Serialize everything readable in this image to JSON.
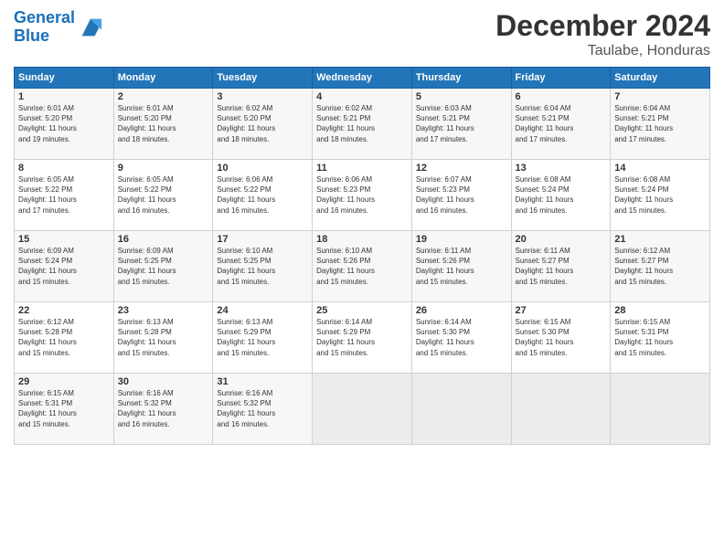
{
  "header": {
    "logo_line1": "General",
    "logo_line2": "Blue",
    "month_title": "December 2024",
    "location": "Taulabe, Honduras"
  },
  "days_of_week": [
    "Sunday",
    "Monday",
    "Tuesday",
    "Wednesday",
    "Thursday",
    "Friday",
    "Saturday"
  ],
  "weeks": [
    [
      {
        "day": "1",
        "detail": "Sunrise: 6:01 AM\nSunset: 5:20 PM\nDaylight: 11 hours\nand 19 minutes."
      },
      {
        "day": "2",
        "detail": "Sunrise: 6:01 AM\nSunset: 5:20 PM\nDaylight: 11 hours\nand 18 minutes."
      },
      {
        "day": "3",
        "detail": "Sunrise: 6:02 AM\nSunset: 5:20 PM\nDaylight: 11 hours\nand 18 minutes."
      },
      {
        "day": "4",
        "detail": "Sunrise: 6:02 AM\nSunset: 5:21 PM\nDaylight: 11 hours\nand 18 minutes."
      },
      {
        "day": "5",
        "detail": "Sunrise: 6:03 AM\nSunset: 5:21 PM\nDaylight: 11 hours\nand 17 minutes."
      },
      {
        "day": "6",
        "detail": "Sunrise: 6:04 AM\nSunset: 5:21 PM\nDaylight: 11 hours\nand 17 minutes."
      },
      {
        "day": "7",
        "detail": "Sunrise: 6:04 AM\nSunset: 5:21 PM\nDaylight: 11 hours\nand 17 minutes."
      }
    ],
    [
      {
        "day": "8",
        "detail": "Sunrise: 6:05 AM\nSunset: 5:22 PM\nDaylight: 11 hours\nand 17 minutes."
      },
      {
        "day": "9",
        "detail": "Sunrise: 6:05 AM\nSunset: 5:22 PM\nDaylight: 11 hours\nand 16 minutes."
      },
      {
        "day": "10",
        "detail": "Sunrise: 6:06 AM\nSunset: 5:22 PM\nDaylight: 11 hours\nand 16 minutes."
      },
      {
        "day": "11",
        "detail": "Sunrise: 6:06 AM\nSunset: 5:23 PM\nDaylight: 11 hours\nand 16 minutes."
      },
      {
        "day": "12",
        "detail": "Sunrise: 6:07 AM\nSunset: 5:23 PM\nDaylight: 11 hours\nand 16 minutes."
      },
      {
        "day": "13",
        "detail": "Sunrise: 6:08 AM\nSunset: 5:24 PM\nDaylight: 11 hours\nand 16 minutes."
      },
      {
        "day": "14",
        "detail": "Sunrise: 6:08 AM\nSunset: 5:24 PM\nDaylight: 11 hours\nand 15 minutes."
      }
    ],
    [
      {
        "day": "15",
        "detail": "Sunrise: 6:09 AM\nSunset: 5:24 PM\nDaylight: 11 hours\nand 15 minutes."
      },
      {
        "day": "16",
        "detail": "Sunrise: 6:09 AM\nSunset: 5:25 PM\nDaylight: 11 hours\nand 15 minutes."
      },
      {
        "day": "17",
        "detail": "Sunrise: 6:10 AM\nSunset: 5:25 PM\nDaylight: 11 hours\nand 15 minutes."
      },
      {
        "day": "18",
        "detail": "Sunrise: 6:10 AM\nSunset: 5:26 PM\nDaylight: 11 hours\nand 15 minutes."
      },
      {
        "day": "19",
        "detail": "Sunrise: 6:11 AM\nSunset: 5:26 PM\nDaylight: 11 hours\nand 15 minutes."
      },
      {
        "day": "20",
        "detail": "Sunrise: 6:11 AM\nSunset: 5:27 PM\nDaylight: 11 hours\nand 15 minutes."
      },
      {
        "day": "21",
        "detail": "Sunrise: 6:12 AM\nSunset: 5:27 PM\nDaylight: 11 hours\nand 15 minutes."
      }
    ],
    [
      {
        "day": "22",
        "detail": "Sunrise: 6:12 AM\nSunset: 5:28 PM\nDaylight: 11 hours\nand 15 minutes."
      },
      {
        "day": "23",
        "detail": "Sunrise: 6:13 AM\nSunset: 5:28 PM\nDaylight: 11 hours\nand 15 minutes."
      },
      {
        "day": "24",
        "detail": "Sunrise: 6:13 AM\nSunset: 5:29 PM\nDaylight: 11 hours\nand 15 minutes."
      },
      {
        "day": "25",
        "detail": "Sunrise: 6:14 AM\nSunset: 5:29 PM\nDaylight: 11 hours\nand 15 minutes."
      },
      {
        "day": "26",
        "detail": "Sunrise: 6:14 AM\nSunset: 5:30 PM\nDaylight: 11 hours\nand 15 minutes."
      },
      {
        "day": "27",
        "detail": "Sunrise: 6:15 AM\nSunset: 5:30 PM\nDaylight: 11 hours\nand 15 minutes."
      },
      {
        "day": "28",
        "detail": "Sunrise: 6:15 AM\nSunset: 5:31 PM\nDaylight: 11 hours\nand 15 minutes."
      }
    ],
    [
      {
        "day": "29",
        "detail": "Sunrise: 6:15 AM\nSunset: 5:31 PM\nDaylight: 11 hours\nand 15 minutes."
      },
      {
        "day": "30",
        "detail": "Sunrise: 6:16 AM\nSunset: 5:32 PM\nDaylight: 11 hours\nand 16 minutes."
      },
      {
        "day": "31",
        "detail": "Sunrise: 6:16 AM\nSunset: 5:32 PM\nDaylight: 11 hours\nand 16 minutes."
      },
      null,
      null,
      null,
      null
    ]
  ]
}
